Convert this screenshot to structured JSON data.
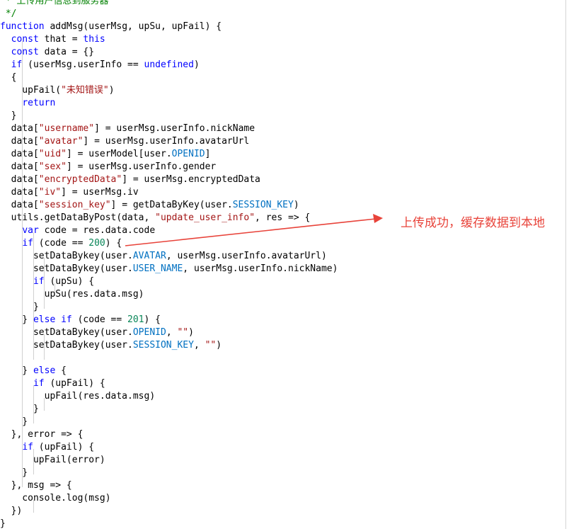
{
  "editor": {
    "colors": {
      "keyword": "#0000ff",
      "string": "#a31515",
      "number": "#098658",
      "constant": "#0070c1",
      "comment": "#008000",
      "annotation": "#e8433a"
    },
    "lines": [
      [
        {
          "t": " * 上传用户信息到服务器",
          "c": "comment"
        }
      ],
      [
        {
          "t": " */",
          "c": "comment"
        }
      ],
      [
        {
          "t": "function",
          "c": "kw"
        },
        {
          "t": " addMsg(userMsg, upSu, upFail) {"
        }
      ],
      [
        {
          "t": "  "
        },
        {
          "t": "const",
          "c": "kw"
        },
        {
          "t": " that = "
        },
        {
          "t": "this",
          "c": "kw"
        }
      ],
      [
        {
          "t": "  "
        },
        {
          "t": "const",
          "c": "kw"
        },
        {
          "t": " data = {}"
        }
      ],
      [
        {
          "t": "  "
        },
        {
          "t": "if",
          "c": "kw"
        },
        {
          "t": " (userMsg.userInfo == "
        },
        {
          "t": "undefined",
          "c": "kw"
        },
        {
          "t": ")"
        }
      ],
      [
        {
          "t": "  {"
        }
      ],
      [
        {
          "t": "    upFail("
        },
        {
          "t": "\"未知错误\"",
          "c": "str"
        },
        {
          "t": ")"
        }
      ],
      [
        {
          "t": "    "
        },
        {
          "t": "return",
          "c": "kw"
        }
      ],
      [
        {
          "t": "  }"
        }
      ],
      [
        {
          "t": "  data["
        },
        {
          "t": "\"username\"",
          "c": "str"
        },
        {
          "t": "] = userMsg.userInfo.nickName"
        }
      ],
      [
        {
          "t": "  data["
        },
        {
          "t": "\"avatar\"",
          "c": "str"
        },
        {
          "t": "] = userMsg.userInfo.avatarUrl"
        }
      ],
      [
        {
          "t": "  data["
        },
        {
          "t": "\"uid\"",
          "c": "str"
        },
        {
          "t": "] = userModel[user."
        },
        {
          "t": "OPENID",
          "c": "const"
        },
        {
          "t": "]"
        }
      ],
      [
        {
          "t": "  data["
        },
        {
          "t": "\"sex\"",
          "c": "str"
        },
        {
          "t": "] = userMsg.userInfo.gender"
        }
      ],
      [
        {
          "t": "  data["
        },
        {
          "t": "\"encryptedData\"",
          "c": "str"
        },
        {
          "t": "] = userMsg.encryptedData"
        }
      ],
      [
        {
          "t": "  data["
        },
        {
          "t": "\"iv\"",
          "c": "str"
        },
        {
          "t": "] = userMsg.iv"
        }
      ],
      [
        {
          "t": "  data["
        },
        {
          "t": "\"session_key\"",
          "c": "str"
        },
        {
          "t": "] = getDataByKey(user."
        },
        {
          "t": "SESSION_KEY",
          "c": "const"
        },
        {
          "t": ")"
        }
      ],
      [
        {
          "t": "  utils.getDataByPost(data, "
        },
        {
          "t": "\"update_user_info\"",
          "c": "str"
        },
        {
          "t": ", res => {"
        }
      ],
      [
        {
          "t": "    "
        },
        {
          "t": "var",
          "c": "kw"
        },
        {
          "t": " code = res.data.code"
        }
      ],
      [
        {
          "t": "    "
        },
        {
          "t": "if",
          "c": "kw"
        },
        {
          "t": " (code == "
        },
        {
          "t": "200",
          "c": "num"
        },
        {
          "t": ") {"
        }
      ],
      [
        {
          "t": "      setDataBykey(user."
        },
        {
          "t": "AVATAR",
          "c": "const"
        },
        {
          "t": ", userMsg.userInfo.avatarUrl)"
        }
      ],
      [
        {
          "t": "      setDataBykey(user."
        },
        {
          "t": "USER_NAME",
          "c": "const"
        },
        {
          "t": ", userMsg.userInfo.nickName)"
        }
      ],
      [
        {
          "t": "      "
        },
        {
          "t": "if",
          "c": "kw"
        },
        {
          "t": " (upSu) {"
        }
      ],
      [
        {
          "t": "        upSu(res.data.msg)"
        }
      ],
      [
        {
          "t": "      }"
        }
      ],
      [
        {
          "t": "    } "
        },
        {
          "t": "else",
          "c": "kw"
        },
        {
          "t": " "
        },
        {
          "t": "if",
          "c": "kw"
        },
        {
          "t": " (code == "
        },
        {
          "t": "201",
          "c": "num"
        },
        {
          "t": ") {"
        }
      ],
      [
        {
          "t": "      setDataBykey(user."
        },
        {
          "t": "OPENID",
          "c": "const"
        },
        {
          "t": ", "
        },
        {
          "t": "\"\"",
          "c": "str"
        },
        {
          "t": ")"
        }
      ],
      [
        {
          "t": "      setDataBykey(user."
        },
        {
          "t": "SESSION_KEY",
          "c": "const"
        },
        {
          "t": ", "
        },
        {
          "t": "\"\"",
          "c": "str"
        },
        {
          "t": ")"
        }
      ],
      [],
      [
        {
          "t": "    } "
        },
        {
          "t": "else",
          "c": "kw"
        },
        {
          "t": " {"
        }
      ],
      [
        {
          "t": "      "
        },
        {
          "t": "if",
          "c": "kw"
        },
        {
          "t": " (upFail) {"
        }
      ],
      [
        {
          "t": "        upFail(res.data.msg)"
        }
      ],
      [
        {
          "t": "      }"
        }
      ],
      [
        {
          "t": "    }"
        }
      ],
      [
        {
          "t": "  }, error => {"
        }
      ],
      [
        {
          "t": "    "
        },
        {
          "t": "if",
          "c": "kw"
        },
        {
          "t": " (upFail) {"
        }
      ],
      [
        {
          "t": "      upFail(error)"
        }
      ],
      [
        {
          "t": "    }"
        }
      ],
      [
        {
          "t": "  }, msg => {"
        }
      ],
      [
        {
          "t": "    console.log(msg)"
        }
      ],
      [
        {
          "t": "  })"
        }
      ],
      [
        {
          "t": "}"
        }
      ]
    ]
  },
  "annotation": {
    "text": "上传成功，缓存数据到本地"
  }
}
